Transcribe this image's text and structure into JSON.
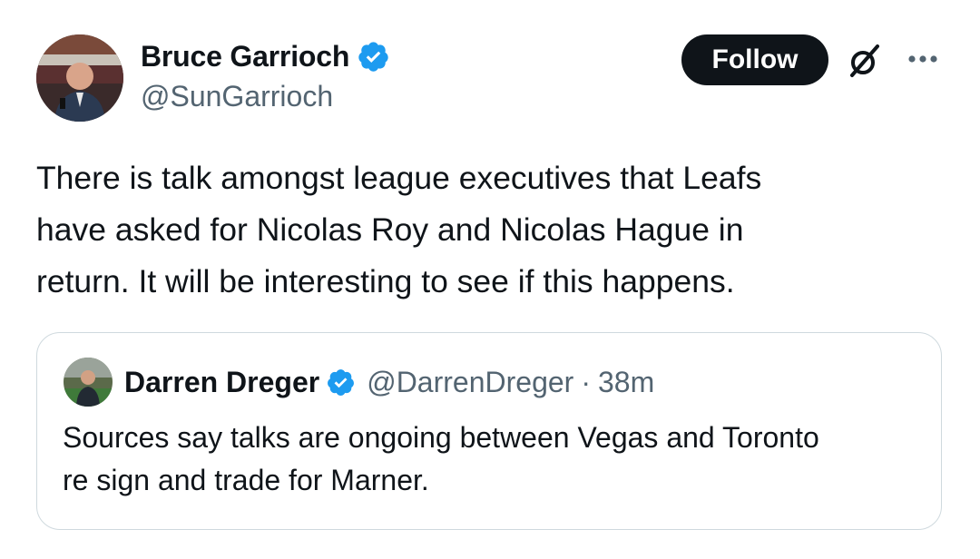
{
  "tweet": {
    "author": {
      "display_name": "Bruce Garrioch",
      "handle": "@SunGarrioch",
      "verified": true
    },
    "follow_label": "Follow",
    "text": "There is talk amongst league executives that  Leafs\nhave asked for Nicolas Roy and Nicolas Hague in\nreturn. It will be interesting to see if this happens.",
    "icons": {
      "grok": "grok-icon",
      "more": "more-options-icon"
    }
  },
  "quote": {
    "author": {
      "display_name": "Darren Dreger",
      "handle": "@DarrenDreger",
      "verified": true
    },
    "separator": "·",
    "time": "38m",
    "text": "Sources say talks are ongoing between Vegas and Toronto\nre sign and trade for Marner."
  },
  "colors": {
    "verified_blue": "#1d9bf0",
    "text_primary": "#0f1419",
    "text_secondary": "#536471",
    "border": "#cfd9de"
  }
}
